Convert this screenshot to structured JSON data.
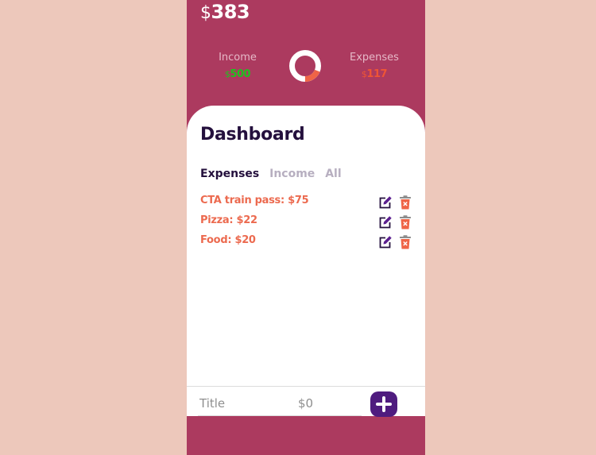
{
  "header": {
    "currency": "$",
    "balance": "383"
  },
  "summary": {
    "income_label": "Income",
    "income_currency": "$",
    "income_value": "500",
    "expenses_label": "Expenses",
    "expenses_currency": "$",
    "expenses_value": "117",
    "expense_share": 0.19,
    "colors": {
      "income": "#1fc21f",
      "expenses": "#ef5535",
      "ring_income": "#ffffff",
      "ring_expense": "#ef6446"
    }
  },
  "dashboard": {
    "title": "Dashboard",
    "tabs": [
      {
        "label": "Expenses",
        "active": true
      },
      {
        "label": "Income",
        "active": false
      },
      {
        "label": "All",
        "active": false
      }
    ],
    "items": [
      {
        "text": "CTA train pass: $75",
        "edit_icon": "edit-icon",
        "delete_icon": "trash-icon"
      },
      {
        "text": "Pizza: $22",
        "edit_icon": "edit-icon",
        "delete_icon": "trash-icon"
      },
      {
        "text": "Food: $20",
        "edit_icon": "edit-icon",
        "delete_icon": "trash-icon"
      }
    ]
  },
  "form": {
    "title_placeholder": "Title",
    "amount_placeholder": "$0",
    "add_icon": "plus-icon"
  }
}
